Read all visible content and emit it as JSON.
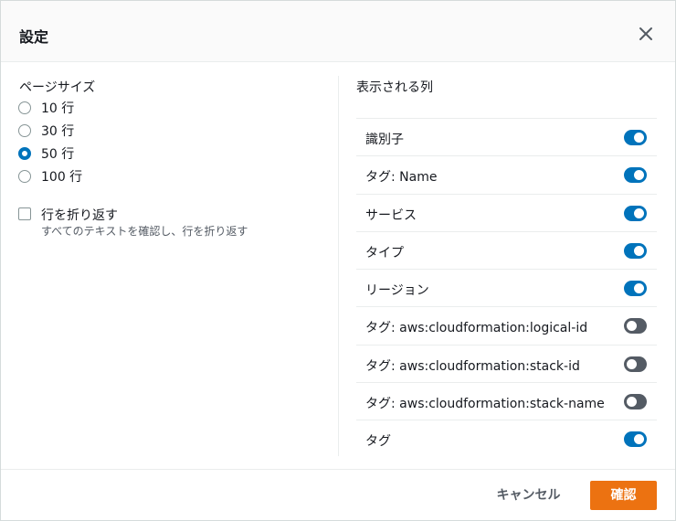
{
  "dialog": {
    "title": "設定",
    "close_icon": "close-icon"
  },
  "page_size": {
    "label": "ページサイズ",
    "options": [
      {
        "label": "10 行",
        "checked": false
      },
      {
        "label": "30 行",
        "checked": false
      },
      {
        "label": "50 行",
        "checked": true
      },
      {
        "label": "100 行",
        "checked": false
      }
    ]
  },
  "wrap_lines": {
    "label": "行を折り返す",
    "description": "すべてのテキストを確認し、行を折り返す",
    "checked": false
  },
  "visible_columns": {
    "label": "表示される列",
    "columns": [
      {
        "name": "識別子",
        "enabled": true
      },
      {
        "name": "タグ: Name",
        "enabled": true
      },
      {
        "name": "サービス",
        "enabled": true
      },
      {
        "name": "タイプ",
        "enabled": true
      },
      {
        "name": "リージョン",
        "enabled": true
      },
      {
        "name": "タグ: aws:cloudformation:logical-id",
        "enabled": false
      },
      {
        "name": "タグ: aws:cloudformation:stack-id",
        "enabled": false
      },
      {
        "name": "タグ: aws:cloudformation:stack-name",
        "enabled": false
      },
      {
        "name": "タグ",
        "enabled": true
      }
    ]
  },
  "footer": {
    "cancel_label": "キャンセル",
    "confirm_label": "確認"
  },
  "colors": {
    "accent": "#0073bb",
    "primary_button": "#ec7211",
    "toggle_off": "#545b64"
  }
}
